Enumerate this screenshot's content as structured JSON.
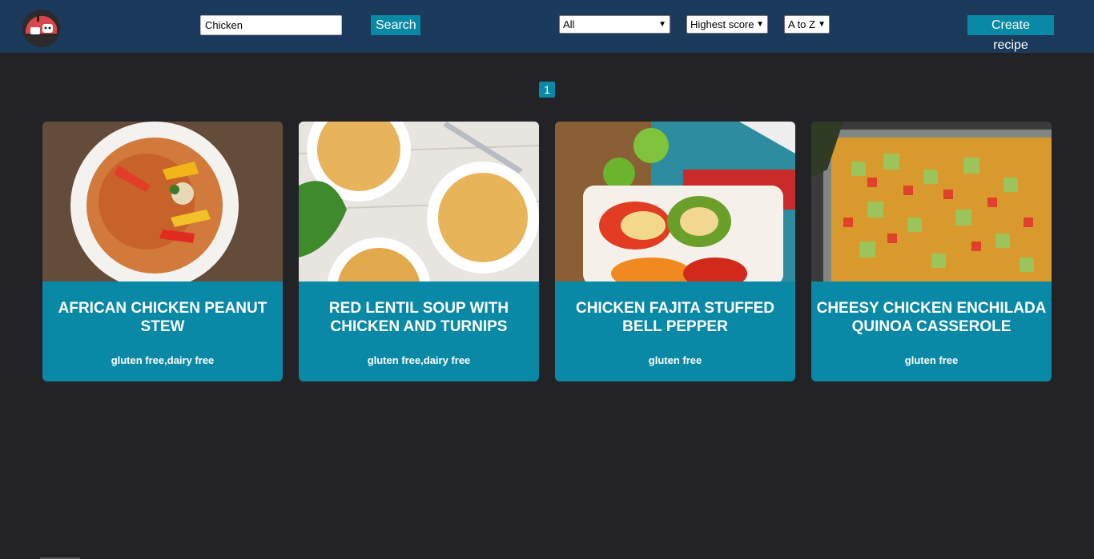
{
  "header": {
    "search_value": "Chicken",
    "search_button": "Search",
    "diet_filter": "All",
    "score_sort": "Highest score",
    "alpha_sort": "A to Z",
    "create_button": "Create recipe",
    "logo_icon": "chef-logo-icon"
  },
  "pagination": {
    "current_page": "1"
  },
  "recipes": [
    {
      "title": "African Chicken Peanut Stew",
      "diets": "gluten free,dairy free"
    },
    {
      "title": "Red Lentil Soup with Chicken and Turnips",
      "diets": "gluten free,dairy free"
    },
    {
      "title": "Chicken Fajita Stuffed Bell Pepper",
      "diets": "gluten free"
    },
    {
      "title": "Cheesy Chicken Enchilada Quinoa Casserole",
      "diets": "gluten free"
    }
  ],
  "colors": {
    "header_bg": "#1b3a5c",
    "page_bg": "#222227",
    "accent": "#0a89a6"
  }
}
